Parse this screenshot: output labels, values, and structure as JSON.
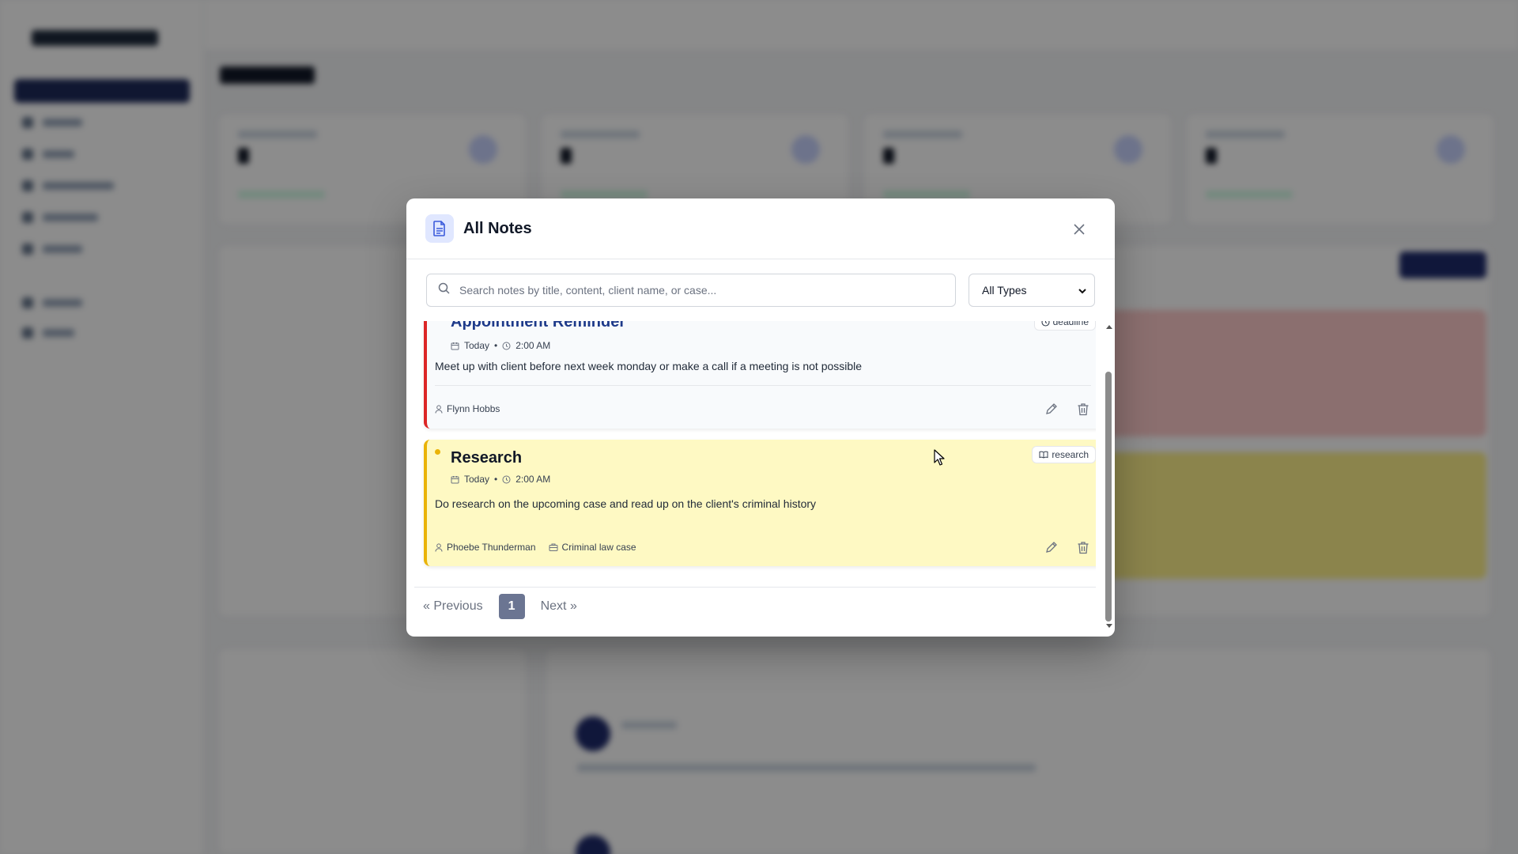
{
  "modal": {
    "title": "All Notes",
    "search_placeholder": "Search notes by title, content, client name, or case...",
    "type_filter": {
      "selected": "All Types",
      "options": [
        "All Types"
      ]
    },
    "notes": [
      {
        "title": "Appointment Reminder",
        "date": "Today",
        "time": "2:00 AM",
        "content": "Meet up with client before next week monday or make a call if a meeting is not possible",
        "client": "Flynn Hobbs",
        "tag": "deadline",
        "accent": "#dc2626"
      },
      {
        "title": "Research",
        "date": "Today",
        "time": "2:00 AM",
        "content": "Do research on the upcoming case and read up on the client's criminal history",
        "client": "Phoebe Thunderman",
        "case": "Criminal law case",
        "tag": "research",
        "accent": "#eab308"
      }
    ],
    "pagination": {
      "previous": "« Previous",
      "current": "1",
      "next": "Next »"
    }
  },
  "colors": {
    "overlay": "rgba(0,0,0,0.45)",
    "deadline_accent": "#dc2626",
    "research_accent": "#eab308",
    "research_bg": "#fef9c3",
    "pager_active": "#6b7592"
  }
}
